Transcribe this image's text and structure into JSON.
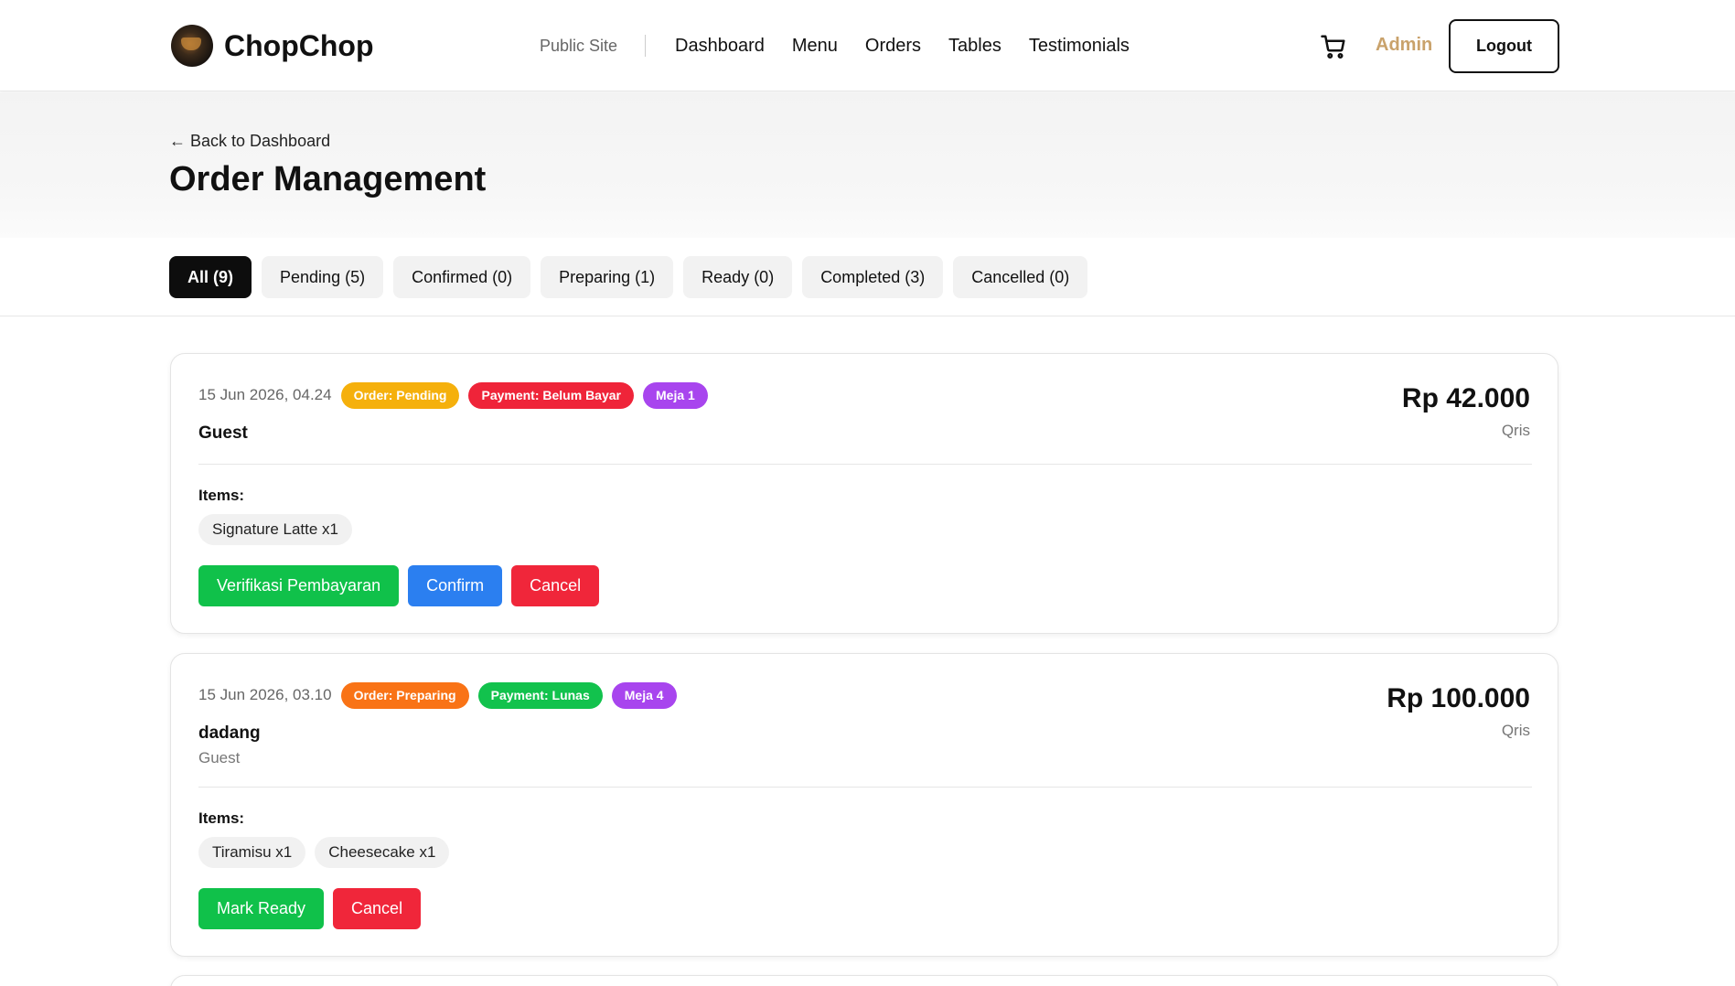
{
  "nav": {
    "brand": "ChopChop",
    "public_site": "Public Site",
    "links": [
      "Dashboard",
      "Menu",
      "Orders",
      "Tables",
      "Testimonials"
    ],
    "admin": "Admin",
    "logout": "Logout"
  },
  "header": {
    "back_link": "← Back to Dashboard",
    "title": "Order Management"
  },
  "filters": [
    {
      "label": "All (9)",
      "active": true
    },
    {
      "label": "Pending (5)",
      "active": false
    },
    {
      "label": "Confirmed (0)",
      "active": false
    },
    {
      "label": "Preparing (1)",
      "active": false
    },
    {
      "label": "Ready (0)",
      "active": false
    },
    {
      "label": "Completed (3)",
      "active": false
    },
    {
      "label": "Cancelled (0)",
      "active": false
    }
  ],
  "orders": [
    {
      "date": "15 Jun 2026, 04.24",
      "order_status": "Order: Pending",
      "payment_status": "Payment: Belum Bayar",
      "table": "Meja 1",
      "customer": "Guest",
      "customer_type": "",
      "total": "Rp 42.000",
      "method": "Qris",
      "items_label": "Items:",
      "items": [
        "Signature Latte x1"
      ],
      "actions": [
        "Verifikasi Pembayaran",
        "Confirm",
        "Cancel"
      ]
    },
    {
      "date": "15 Jun 2026, 03.10",
      "order_status": "Order: Preparing",
      "payment_status": "Payment: Lunas",
      "table": "Meja 4",
      "customer": "dadang",
      "customer_type": "Guest",
      "total": "Rp 100.000",
      "method": "Qris",
      "items_label": "Items:",
      "items": [
        "Tiramisu x1",
        "Cheesecake x1"
      ],
      "actions": [
        "Mark Ready",
        "Cancel"
      ]
    }
  ],
  "colors": {
    "pending": "#f5b00c",
    "preparing": "#f97316",
    "unpaid": "#ef2439",
    "paid": "#12c24d",
    "table": "#a845ee",
    "admin": "#c9a26b"
  },
  "icons": {
    "cart": "cart-icon",
    "logo": "coffee-logo-icon"
  }
}
